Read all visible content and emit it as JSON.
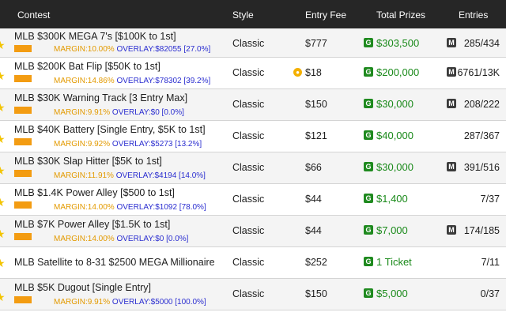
{
  "header": {
    "contest": "Contest",
    "style": "Style",
    "entry_fee": "Entry Fee",
    "total_prizes": "Total Prizes",
    "entries": "Entries"
  },
  "badges": {
    "guaranteed": "G",
    "multi": "M"
  },
  "colors": {
    "header_bg": "#262626",
    "margin": "#e39a00",
    "overlay": "#2b2ed0",
    "prize": "#1a8a1a",
    "star": "#f3c400"
  },
  "rows": [
    {
      "name": "MLB $300K MEGA 7's [$100K to 1st]",
      "margin": "MARGIN:10.00%",
      "overlay": "OVERLAY:$82055 [27.0%]",
      "style": "Classic",
      "fee": "$777",
      "prize": "$303,500",
      "entries": "285/434"
    },
    {
      "name": "MLB $200K Bat Flip [$50K to 1st]",
      "margin": "MARGIN:14.86%",
      "overlay": "OVERLAY:$78302 [39.2%]",
      "style": "Classic",
      "fee": "$18",
      "prize": "$200,000",
      "entries": "6761/13K"
    },
    {
      "name": "MLB $30K Warning Track [3 Entry Max]",
      "margin": "MARGIN:9.91%",
      "overlay": "OVERLAY:$0 [0.0%]",
      "style": "Classic",
      "fee": "$150",
      "prize": "$30,000",
      "entries": "208/222"
    },
    {
      "name": "MLB $40K Battery [Single Entry, $5K to 1st]",
      "margin": "MARGIN:9.92%",
      "overlay": "OVERLAY:$5273 [13.2%]",
      "style": "Classic",
      "fee": "$121",
      "prize": "$40,000",
      "entries": "287/367"
    },
    {
      "name": "MLB $30K Slap Hitter [$5K to 1st]",
      "margin": "MARGIN:11.91%",
      "overlay": "OVERLAY:$4194 [14.0%]",
      "style": "Classic",
      "fee": "$66",
      "prize": "$30,000",
      "entries": "391/516"
    },
    {
      "name": "MLB $1.4K Power Alley [$500 to 1st]",
      "margin": "MARGIN:14.00%",
      "overlay": "OVERLAY:$1092 [78.0%]",
      "style": "Classic",
      "fee": "$44",
      "prize": "$1,400",
      "entries": "7/37"
    },
    {
      "name": "MLB $7K Power Alley [$1.5K to 1st]",
      "margin": "MARGIN:14.00%",
      "overlay": "OVERLAY:$0 [0.0%]",
      "style": "Classic",
      "fee": "$44",
      "prize": "$7,000",
      "entries": "174/185"
    },
    {
      "name": "MLB Satellite to 8-31 $2500 MEGA Millionaire",
      "style": "Classic",
      "fee": "$252",
      "prize": "1 Ticket",
      "entries": "7/11"
    },
    {
      "name": "MLB $5K Dugout [Single Entry]",
      "margin": "MARGIN:9.91%",
      "overlay": "OVERLAY:$5000 [100.0%]",
      "style": "Classic",
      "fee": "$150",
      "prize": "$5,000",
      "entries": "0/37"
    }
  ]
}
